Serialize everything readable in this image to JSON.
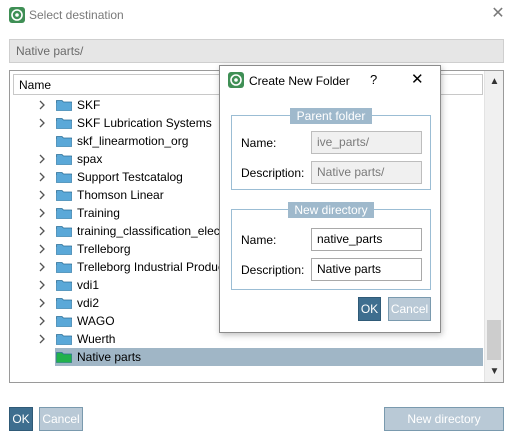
{
  "window": {
    "title": "Select destination",
    "close_glyph": "✕",
    "path": "Native parts/"
  },
  "tree": {
    "header": "Name",
    "items": [
      {
        "label": "SKF",
        "expandable": true,
        "folder_color": "#5aa8d8"
      },
      {
        "label": "SKF Lubrication Systems",
        "expandable": true,
        "folder_color": "#5aa8d8"
      },
      {
        "label": "skf_linearmotion_org",
        "expandable": false,
        "folder_color": "#5aa8d8"
      },
      {
        "label": "spax",
        "expandable": true,
        "folder_color": "#5aa8d8"
      },
      {
        "label": "Support Testcatalog",
        "expandable": true,
        "folder_color": "#5aa8d8"
      },
      {
        "label": "Thomson Linear",
        "expandable": true,
        "folder_color": "#5aa8d8"
      },
      {
        "label": "Training",
        "expandable": true,
        "folder_color": "#5aa8d8"
      },
      {
        "label": "training_classification_elect",
        "expandable": true,
        "folder_color": "#5aa8d8"
      },
      {
        "label": "Trelleborg",
        "expandable": true,
        "folder_color": "#5aa8d8"
      },
      {
        "label": "Trelleborg Industrial Produc",
        "expandable": true,
        "folder_color": "#5aa8d8"
      },
      {
        "label": "vdi1",
        "expandable": true,
        "folder_color": "#5aa8d8"
      },
      {
        "label": "vdi2",
        "expandable": true,
        "folder_color": "#5aa8d8"
      },
      {
        "label": "WAGO",
        "expandable": true,
        "folder_color": "#5aa8d8"
      },
      {
        "label": "Wuerth",
        "expandable": true,
        "folder_color": "#5aa8d8"
      },
      {
        "label": "Native parts",
        "expandable": false,
        "selected": true,
        "folder_color": "#22b14c"
      }
    ]
  },
  "buttons": {
    "ok": "OK",
    "cancel": "Cancel",
    "new_directory": "New directory"
  },
  "dialog": {
    "title": "Create New Folder",
    "help": "?",
    "close_glyph": "✕",
    "parent_group": {
      "legend": "Parent folder",
      "name_label": "Name:",
      "name_value": "ive_parts/",
      "description_label": "Description:",
      "description_value": "Native parts/"
    },
    "new_group": {
      "legend": "New directory",
      "name_label": "Name:",
      "name_value": "native_parts",
      "description_label": "Description:",
      "description_value": "Native parts"
    },
    "ok": "OK",
    "cancel": "Cancel"
  },
  "colors": {
    "accent": "#3e6e8f",
    "accent_disabled": "#b9c9d6",
    "selection": "#a0b6c6",
    "legend_bg": "#9fb9cc"
  }
}
